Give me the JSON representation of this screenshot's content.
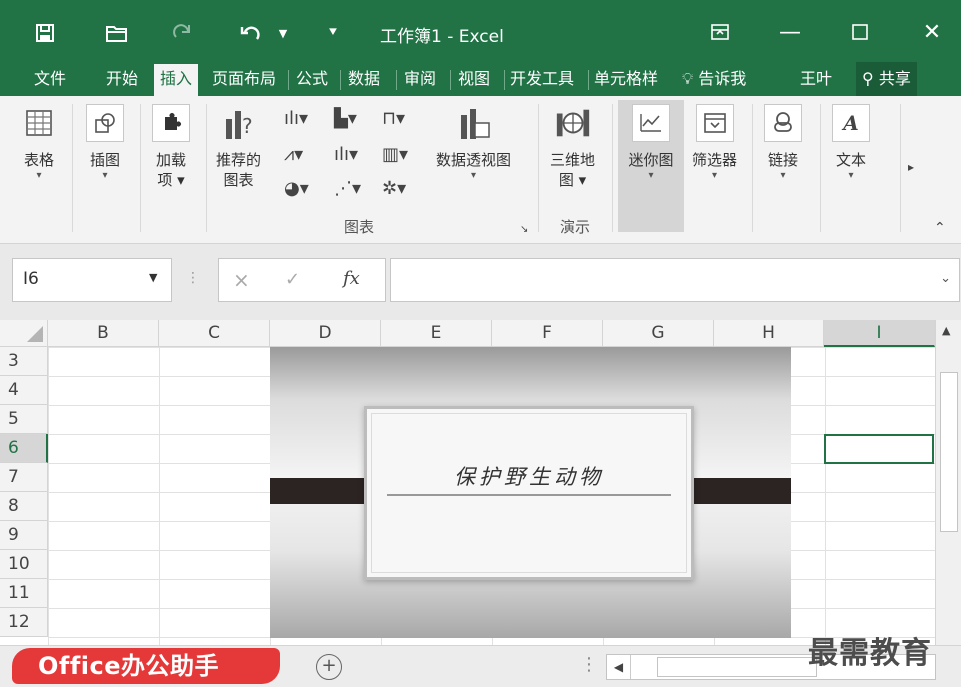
{
  "window": {
    "title": "工作簿1 - Excel",
    "accent_color": "#217346"
  },
  "qat": {
    "save_icon": "save-icon",
    "open_icon": "folder-open-icon",
    "redo_icon": "redo-icon",
    "undo_icon": "undo-icon",
    "customize_icon": "customize-qat-icon"
  },
  "tabs": [
    "文件",
    "开始",
    "插入",
    "页面布局",
    "公式",
    "数据",
    "审阅",
    "视图",
    "开发工具",
    "单元格样"
  ],
  "active_tab": "插入",
  "tell_me": "告诉我",
  "user": "王叶",
  "share_label": "共享",
  "ribbon": {
    "table": {
      "label": "表格"
    },
    "illustrations": {
      "label": "插图"
    },
    "addins": {
      "label_line1": "加载",
      "label_line2": "项"
    },
    "recommended_charts": {
      "label_line1": "推荐的",
      "label_line2": "图表"
    },
    "pivot_chart": {
      "label": "数据透视图"
    },
    "map3d": {
      "label_line1": "三维地",
      "label_line2": "图"
    },
    "sparklines": {
      "label": "迷你图"
    },
    "filters": {
      "label": "筛选器"
    },
    "links": {
      "label": "链接"
    },
    "text": {
      "label": "文本"
    },
    "group_charts": "图表",
    "group_tours": "演示"
  },
  "formula_bar": {
    "name_box": "I6",
    "cancel": "×",
    "enter": "✓",
    "fx": "fx",
    "value": ""
  },
  "grid": {
    "columns": [
      "B",
      "C",
      "D",
      "E",
      "F",
      "G",
      "H",
      "I"
    ],
    "selected_column": "I",
    "rows": [
      "3",
      "4",
      "5",
      "6",
      "7",
      "8",
      "9",
      "10",
      "11",
      "12"
    ],
    "selected_row": "6",
    "selected_cell": "I6"
  },
  "picture": {
    "text": "保护野生动物",
    "bar_color": "#2b2422"
  },
  "bottom": {
    "sheet_tab": "Office办公助手",
    "sheet_tab_color": "#e53939",
    "add_sheet": "+"
  },
  "watermark": "最需教育"
}
